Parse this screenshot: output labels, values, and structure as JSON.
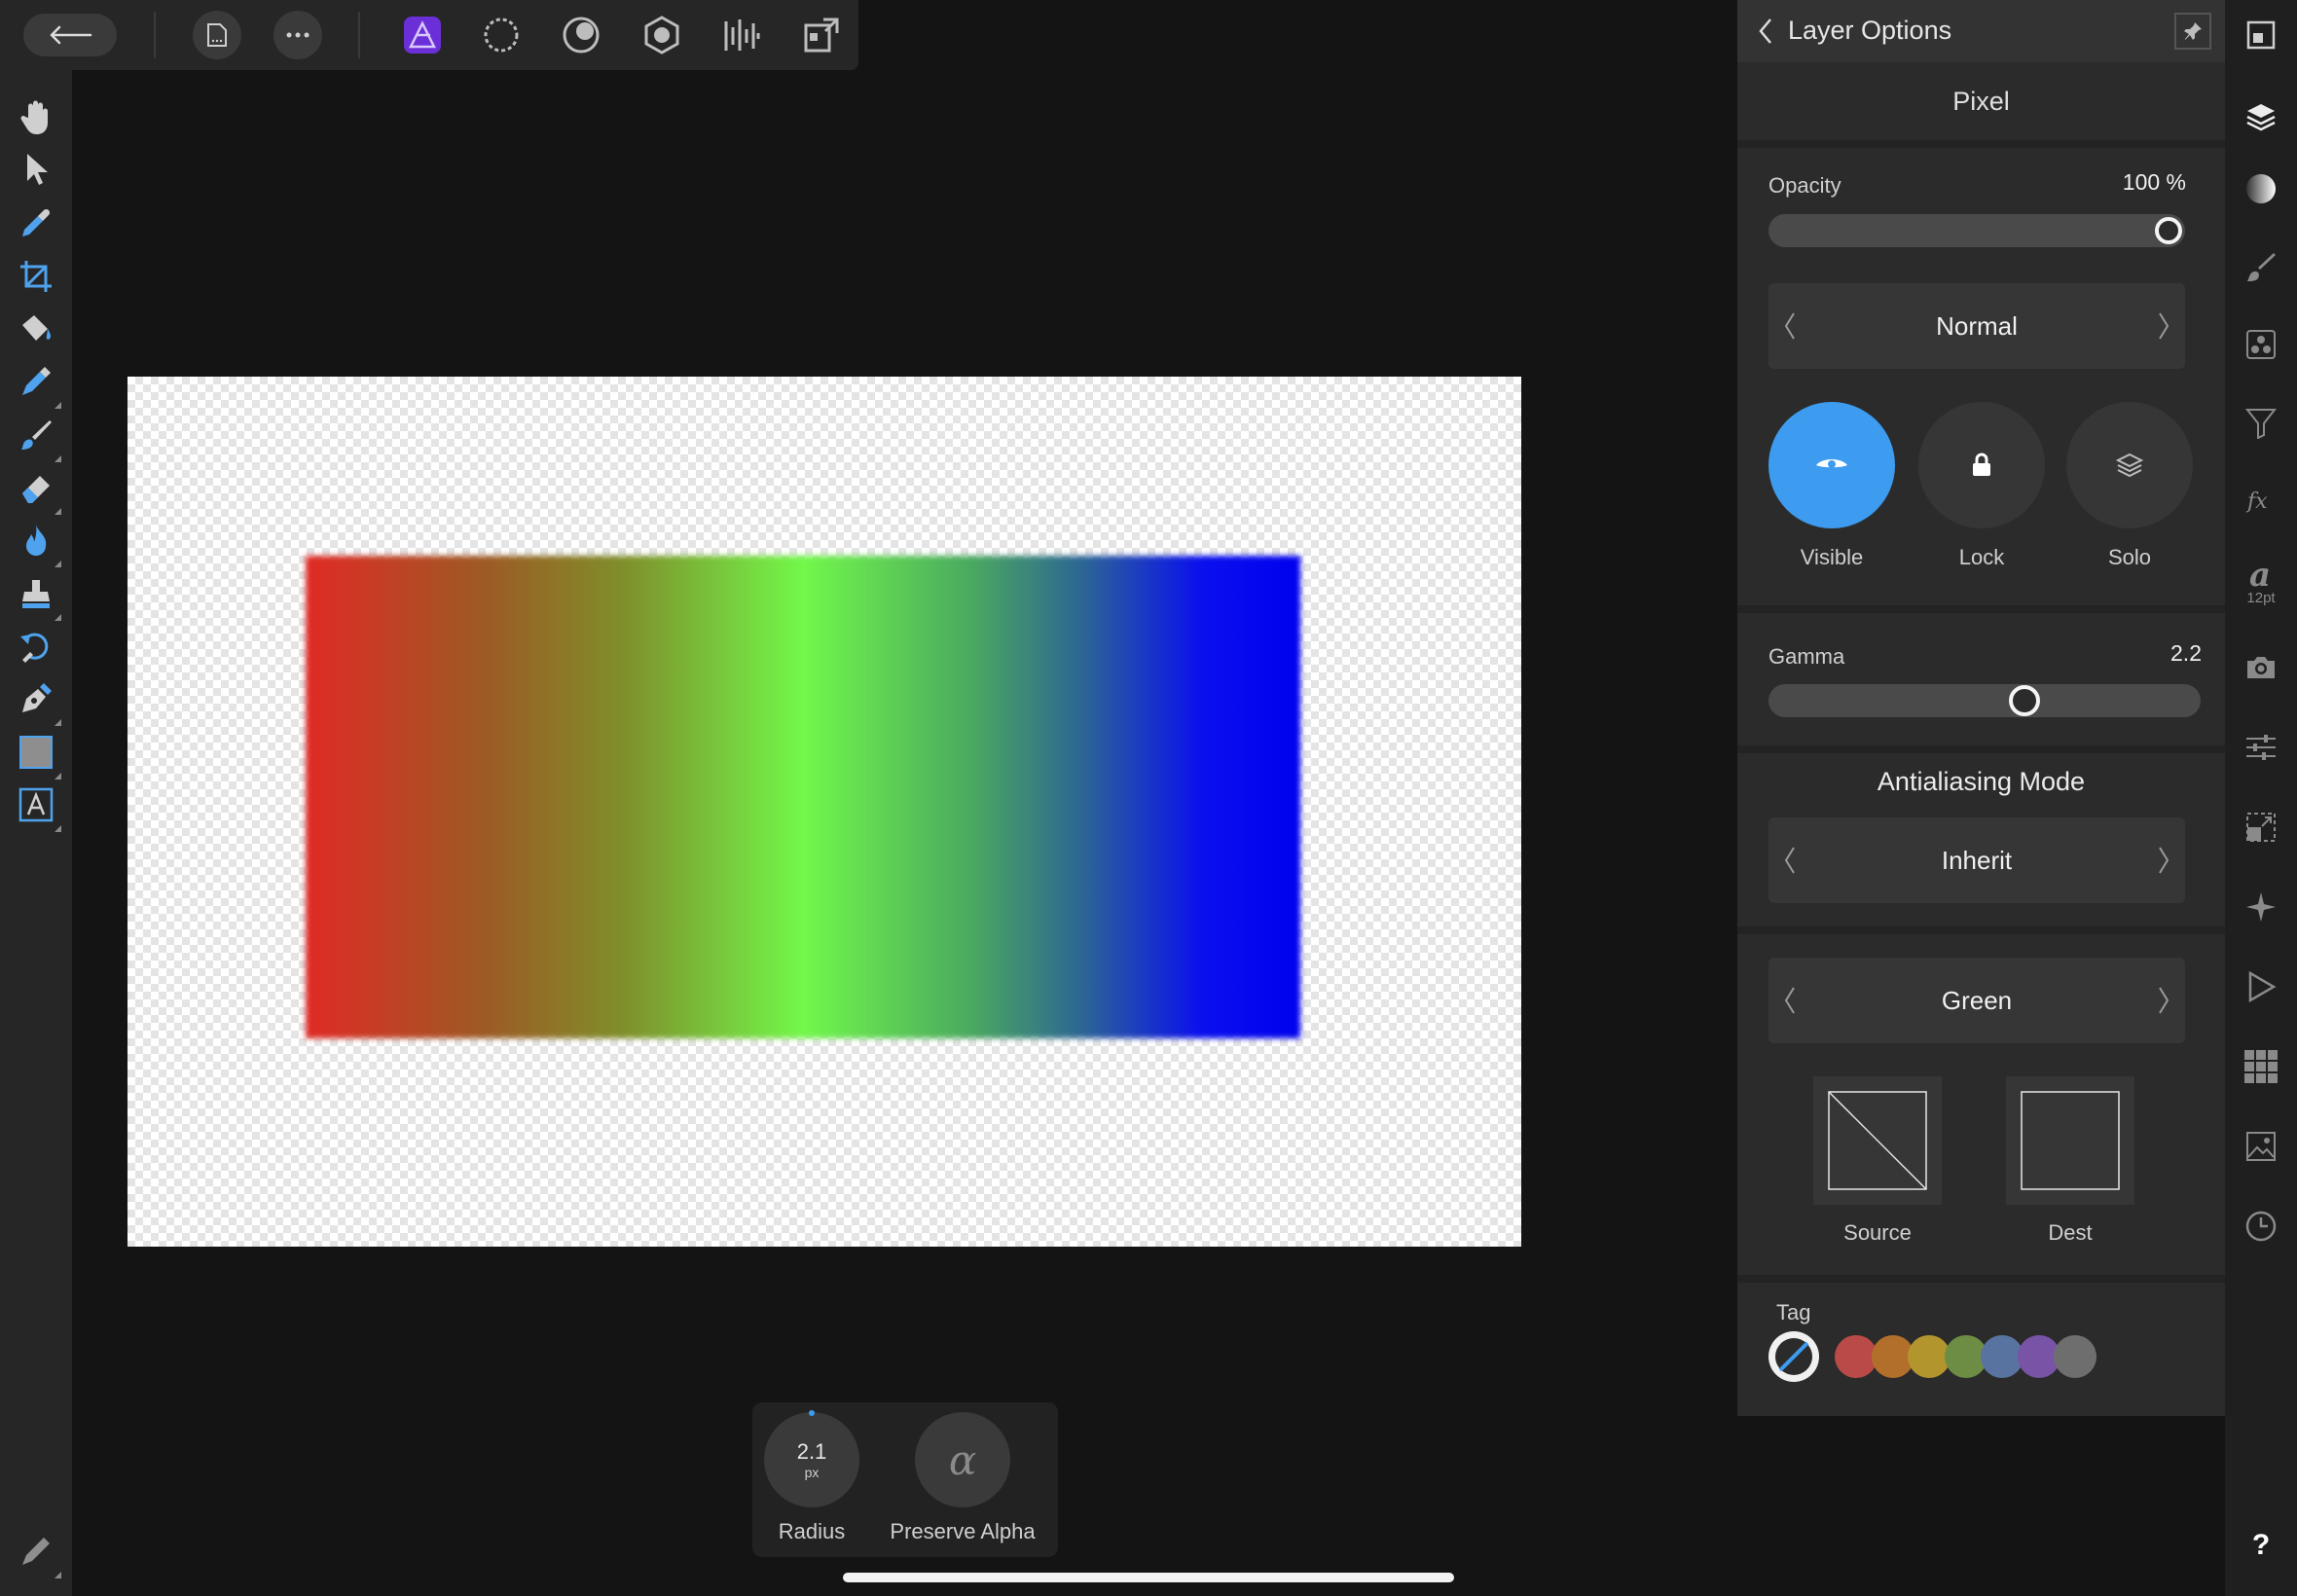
{
  "toolbar": {
    "items": [
      "back-arrow-icon",
      "document-icon",
      "more-icon",
      "photo-persona-icon",
      "liquify-persona-icon",
      "develop-persona-icon",
      "tone-mapping-persona-icon",
      "export-persona-icon",
      "publisher-persona-icon"
    ]
  },
  "tools": [
    "view-tool",
    "move-tool",
    "color-picker-tool",
    "crop-tool",
    "flood-fill-tool",
    "selection-brush-tool",
    "paint-brush-tool",
    "erase-brush-tool",
    "dodge-burn-tool",
    "clone-tool",
    "undo-brush-tool",
    "pen-tool",
    "shape-tool",
    "text-tool",
    "quick-menu-tool"
  ],
  "context": {
    "radius_value": "2.1",
    "radius_unit": "px",
    "radius_label": "Radius",
    "alpha_symbol": "α",
    "alpha_label": "Preserve Alpha"
  },
  "panel": {
    "title": "Layer Options",
    "layer_type": "Pixel",
    "opacity_label": "Opacity",
    "opacity_value": "100 %",
    "opacity_fraction": 1.0,
    "blend_mode": "Normal",
    "toggles": [
      {
        "label": "Visible",
        "active": true
      },
      {
        "label": "Lock",
        "active": false
      },
      {
        "label": "Solo",
        "active": false
      }
    ],
    "gamma_label": "Gamma",
    "gamma_value": "2.2",
    "antialias_title": "Antialiasing Mode",
    "antialias_mode": "Inherit",
    "channel": "Green",
    "source_label": "Source",
    "dest_label": "Dest",
    "tag_label": "Tag",
    "tag_colors": [
      "#b94a47",
      "#b26f2b",
      "#b3952d",
      "#6e8d44",
      "#58739f",
      "#7853a6",
      "#6e6e6e"
    ],
    "accent": "#3d9bf0"
  },
  "studio": {
    "text_size": "12pt",
    "help": "?"
  }
}
